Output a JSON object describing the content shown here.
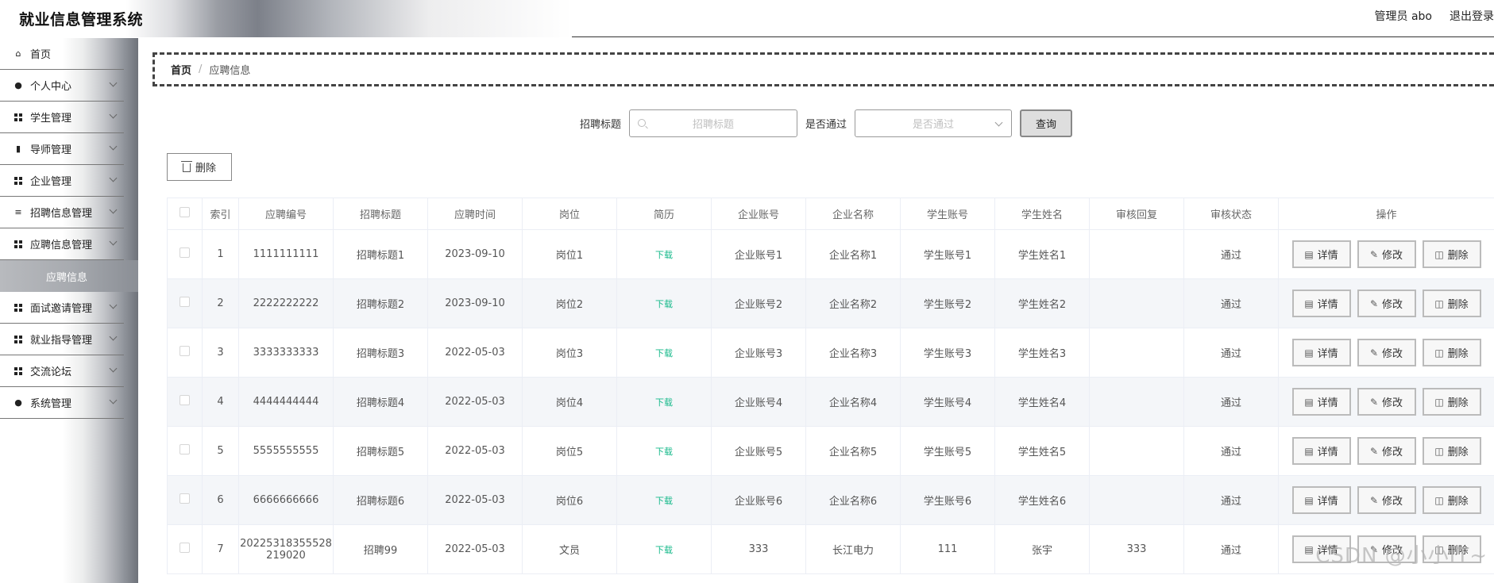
{
  "app": {
    "title": "就业信息管理系统"
  },
  "header": {
    "user": "管理员 abo",
    "logout": "退出登录"
  },
  "sidebar": {
    "items": [
      {
        "label": "首页",
        "icon": "home-icon",
        "expandable": false
      },
      {
        "label": "个人中心",
        "icon": "person-icon",
        "expandable": true
      },
      {
        "label": "学生管理",
        "icon": "grid-icon",
        "expandable": true
      },
      {
        "label": "导师管理",
        "icon": "bar-chart-icon",
        "expandable": true
      },
      {
        "label": "企业管理",
        "icon": "grid-icon",
        "expandable": true
      },
      {
        "label": "招聘信息管理",
        "icon": "list-icon",
        "expandable": true
      },
      {
        "label": "应聘信息管理",
        "icon": "grid-icon",
        "expandable": true
      },
      {
        "label": "面试邀请管理",
        "icon": "grid-icon",
        "expandable": true
      },
      {
        "label": "就业指导管理",
        "icon": "grid-icon",
        "expandable": true
      },
      {
        "label": "交流论坛",
        "icon": "grid-icon",
        "expandable": true
      },
      {
        "label": "系统管理",
        "icon": "person-icon",
        "expandable": true
      }
    ],
    "active_sub": "应聘信息"
  },
  "breadcrumb": {
    "home": "首页",
    "separator": "/",
    "current": "应聘信息"
  },
  "search": {
    "title_label": "招聘标题",
    "title_placeholder": "招聘标题",
    "passed_label": "是否通过",
    "passed_placeholder": "是否通过",
    "query_button": "查询"
  },
  "toolbar": {
    "delete_label": "删除"
  },
  "table": {
    "columns": [
      "索引",
      "应聘编号",
      "招聘标题",
      "应聘时间",
      "岗位",
      "简历",
      "企业账号",
      "企业名称",
      "学生账号",
      "学生姓名",
      "审核回复",
      "审核状态",
      "操作"
    ],
    "rows": [
      [
        "1",
        "1111111111",
        "招聘标题1",
        "2023-09-10",
        "岗位1",
        "下载",
        "企业账号1",
        "企业名称1",
        "学生账号1",
        "学生姓名1",
        "",
        "通过"
      ],
      [
        "2",
        "2222222222",
        "招聘标题2",
        "2023-09-10",
        "岗位2",
        "下载",
        "企业账号2",
        "企业名称2",
        "学生账号2",
        "学生姓名2",
        "",
        "通过"
      ],
      [
        "3",
        "3333333333",
        "招聘标题3",
        "2022-05-03",
        "岗位3",
        "下载",
        "企业账号3",
        "企业名称3",
        "学生账号3",
        "学生姓名3",
        "",
        "通过"
      ],
      [
        "4",
        "4444444444",
        "招聘标题4",
        "2022-05-03",
        "岗位4",
        "下载",
        "企业账号4",
        "企业名称4",
        "学生账号4",
        "学生姓名4",
        "",
        "通过"
      ],
      [
        "5",
        "5555555555",
        "招聘标题5",
        "2022-05-03",
        "岗位5",
        "下载",
        "企业账号5",
        "企业名称5",
        "学生账号5",
        "学生姓名5",
        "",
        "通过"
      ],
      [
        "6",
        "6666666666",
        "招聘标题6",
        "2022-05-03",
        "岗位6",
        "下载",
        "企业账号6",
        "企业名称6",
        "学生账号6",
        "学生姓名6",
        "",
        "通过"
      ],
      [
        "7",
        "20225318355528219020",
        "招聘99",
        "2022-05-03",
        "文员",
        "下载",
        "333",
        "长江电力",
        "111",
        "张宇",
        "333",
        "通过"
      ]
    ],
    "row_actions": {
      "detail": "详情",
      "edit": "修改",
      "delete": "删除"
    }
  },
  "watermark": "CSDN @小小IT~",
  "colors": {
    "download_link": "#16b98a",
    "row_alt_bg": "#f4f6f9"
  }
}
